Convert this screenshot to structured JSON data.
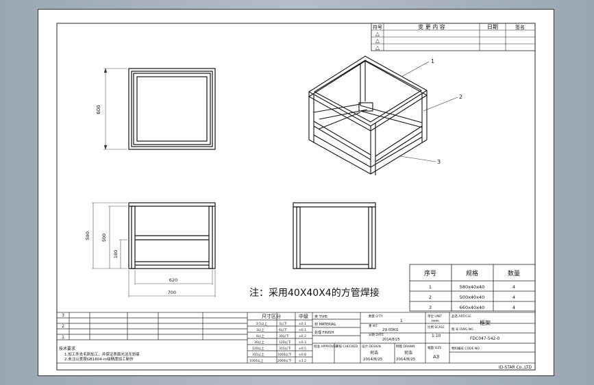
{
  "revision_block": {
    "headers": [
      "符号",
      "变 更 内 容",
      "日期",
      "签名"
    ],
    "marks": [
      "△",
      "△",
      "△"
    ]
  },
  "balloons": [
    "1",
    "2",
    "3"
  ],
  "dimensions": {
    "front_height": "600",
    "side_dims": [
      "580",
      "500",
      "180"
    ],
    "side_widths": [
      "620",
      "700"
    ]
  },
  "note": "注：采用40X40X4的方管焊接",
  "bom": {
    "headers": [
      "序号",
      "规格",
      "数量"
    ],
    "rows": [
      [
        "1",
        "580x40x40",
        "4"
      ],
      [
        "2",
        "500x40x40",
        "4"
      ],
      [
        "3",
        "660x40x40",
        "4"
      ]
    ]
  },
  "title_block": {
    "tech_req_title": "技术要求",
    "tech_req": [
      "1.加工件去毛刺加工、并保证表面光洁无划痕",
      "2.未注公差按GB1804-m级精度加工制作"
    ],
    "left_rows": [
      "3",
      "2",
      "1"
    ],
    "size_header": "尺寸区分",
    "tol_header": "中级",
    "size_rows": [
      [
        "0.5以上",
        "3以下",
        "±0.1"
      ],
      [
        "3以上",
        "6以下",
        "±0.1"
      ],
      [
        "6以上",
        "30以下",
        "±0.2"
      ],
      [
        "30以上",
        "120以下",
        "±0.3"
      ],
      [
        "120以上",
        "315以下",
        "±0.5"
      ],
      [
        "315以上",
        "1000以下",
        "±0.8"
      ],
      [
        "1000以上",
        "2000以下",
        "±1.2"
      ]
    ],
    "type_label": "类 TYPE",
    "material_label": "材 MATERIAL",
    "finish_label": "处理 FINISH",
    "approved_label": "批准 APPROVED",
    "checked_label": "审核 CHECKED",
    "design_label": "设计 DESIGN",
    "drawn_label": "制图 DRAWN",
    "designer": "何浩",
    "drawer": "何浩",
    "design_date": "2014/8/25",
    "drawn_date": "2014/8/25",
    "qty_label": "数量 Q'TY",
    "qty": "1",
    "weight_label": "重 WT",
    "weight": "29.03KG",
    "date_label": "日期 DATE",
    "date": "2014/8/25",
    "unit_label": "单位 UNIT",
    "unit": "mm",
    "scale_label": "比例 SCALE",
    "scale": "1:10",
    "size_label": "幅面 SIZE",
    "size": "A3",
    "name_label": "品名 ARTICLE",
    "name": "框架",
    "drawing_no_label": "图 号 DWG NO.",
    "drawing_no": "FDC047-542-0",
    "code_label": "物料编号 CODE NO.",
    "company": "ID-STAR Co.,LTD"
  }
}
